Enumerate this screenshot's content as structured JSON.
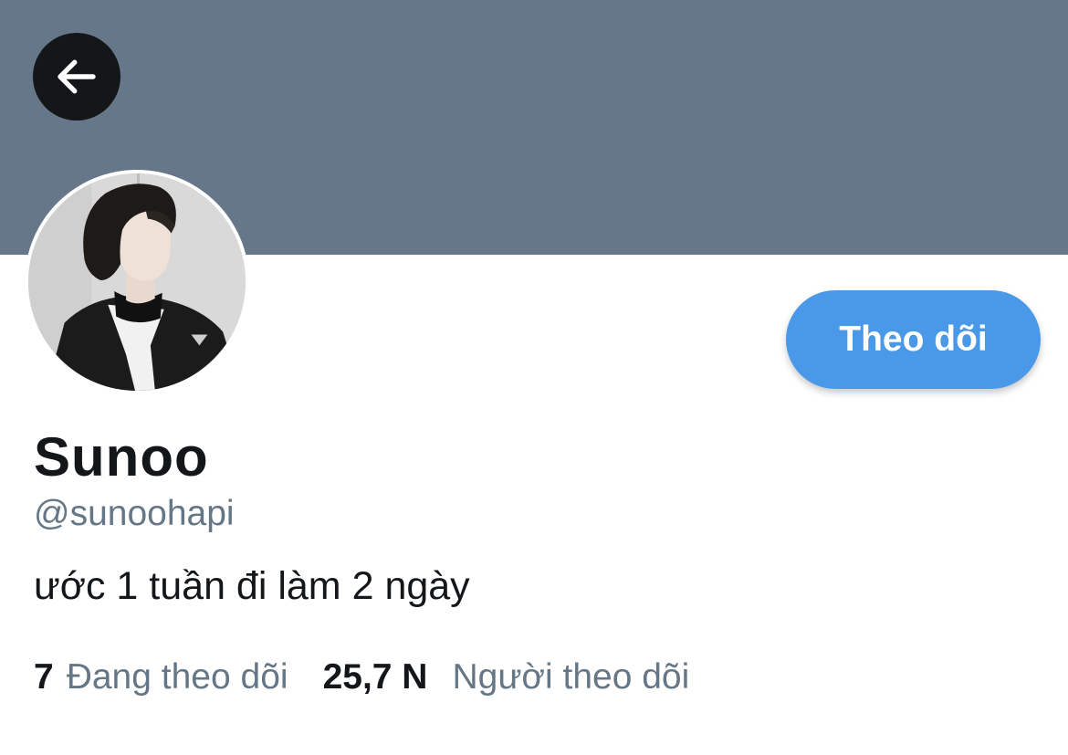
{
  "header": {
    "back_icon": "arrow-left-icon",
    "banner_color": "#66778a"
  },
  "profile": {
    "avatar_icon": "profile-photo",
    "display_name": "Sunoo",
    "handle": "@sunoohapi",
    "bio": "ước 1 tuần đi làm 2 ngày",
    "follow_button_label": "Theo dõi",
    "accent_color": "#4a99e9"
  },
  "stats": {
    "following_count": "7",
    "following_label": "Đang theo dõi",
    "followers_count": "25,7 N",
    "followers_label": "Người theo dõi"
  }
}
